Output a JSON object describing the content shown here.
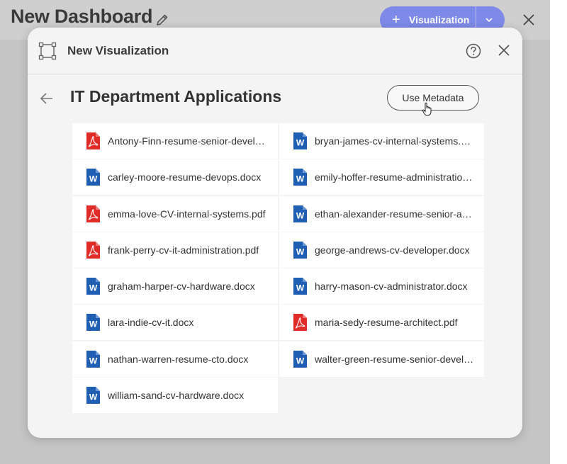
{
  "dashboard": {
    "title": "New Dashboard",
    "visualization_button": "Visualization"
  },
  "modal": {
    "title": "New Visualization",
    "folder_title": "IT Department Applications",
    "metadata_button": "Use Metadata"
  },
  "files": [
    {
      "name": "Antony-Finn-resume-senior-developer.pdf",
      "type": "pdf"
    },
    {
      "name": "bryan-james-cv-internal-systems.docx",
      "type": "docx"
    },
    {
      "name": "carley-moore-resume-devops.docx",
      "type": "docx"
    },
    {
      "name": "emily-hoffer-resume-administration.docx",
      "type": "docx"
    },
    {
      "name": "emma-love-CV-internal-systems.pdf",
      "type": "pdf"
    },
    {
      "name": "ethan-alexander-resume-senior-architect.docx",
      "type": "docx"
    },
    {
      "name": "frank-perry-cv-it-administration.pdf",
      "type": "pdf"
    },
    {
      "name": "george-andrews-cv-developer.docx",
      "type": "docx"
    },
    {
      "name": "graham-harper-cv-hardware.docx",
      "type": "docx"
    },
    {
      "name": "harry-mason-cv-administrator.docx",
      "type": "docx"
    },
    {
      "name": "lara-indie-cv-it.docx",
      "type": "docx"
    },
    {
      "name": "maria-sedy-resume-architect.pdf",
      "type": "pdf"
    },
    {
      "name": "nathan-warren-resume-cto.docx",
      "type": "docx"
    },
    {
      "name": "walter-green-resume-senior-developer.docx",
      "type": "docx"
    },
    {
      "name": "william-sand-cv-hardware.docx",
      "type": "docx"
    }
  ],
  "icons": {
    "pdf": "pdf-file-icon",
    "docx": "word-file-icon"
  },
  "colors": {
    "pdf_red": "#e02b27",
    "word_blue": "#1e5fb4",
    "accent": "#7d8ae8"
  }
}
